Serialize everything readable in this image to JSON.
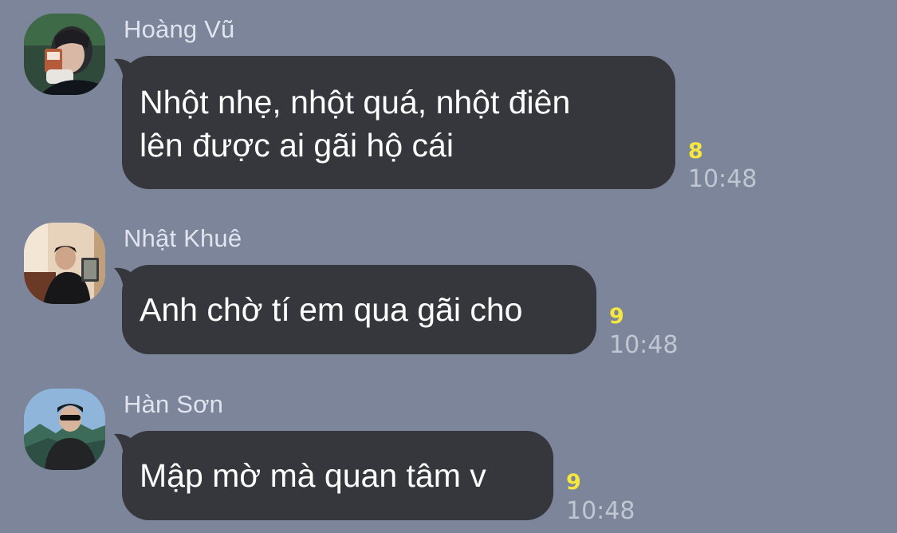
{
  "chat": {
    "messages": [
      {
        "sender": "Hoàng Vũ",
        "avatar": "avatar-hoang-vu",
        "lines": [
          "Nhột nhẹ, nhột quá, nhột điên",
          "lên được ai gãi hộ cái"
        ],
        "read_count": "8",
        "time": "10:48"
      },
      {
        "sender": "Nhật Khuê",
        "avatar": "avatar-nhat-khue",
        "lines": [
          "Anh chờ tí em qua gãi cho"
        ],
        "read_count": "9",
        "time": "10:48"
      },
      {
        "sender": "Hàn Sơn",
        "avatar": "avatar-han-son",
        "lines": [
          "Mập mờ mà quan tâm v"
        ],
        "read_count": "9",
        "time": "10:48"
      }
    ]
  },
  "colors": {
    "background": "#7c8599",
    "bubble": "#36373c",
    "bubble_text": "#ffffff",
    "sender_name": "#dfe4ee",
    "read_count": "#f6e83c",
    "timestamp": "#c1c7d2"
  }
}
